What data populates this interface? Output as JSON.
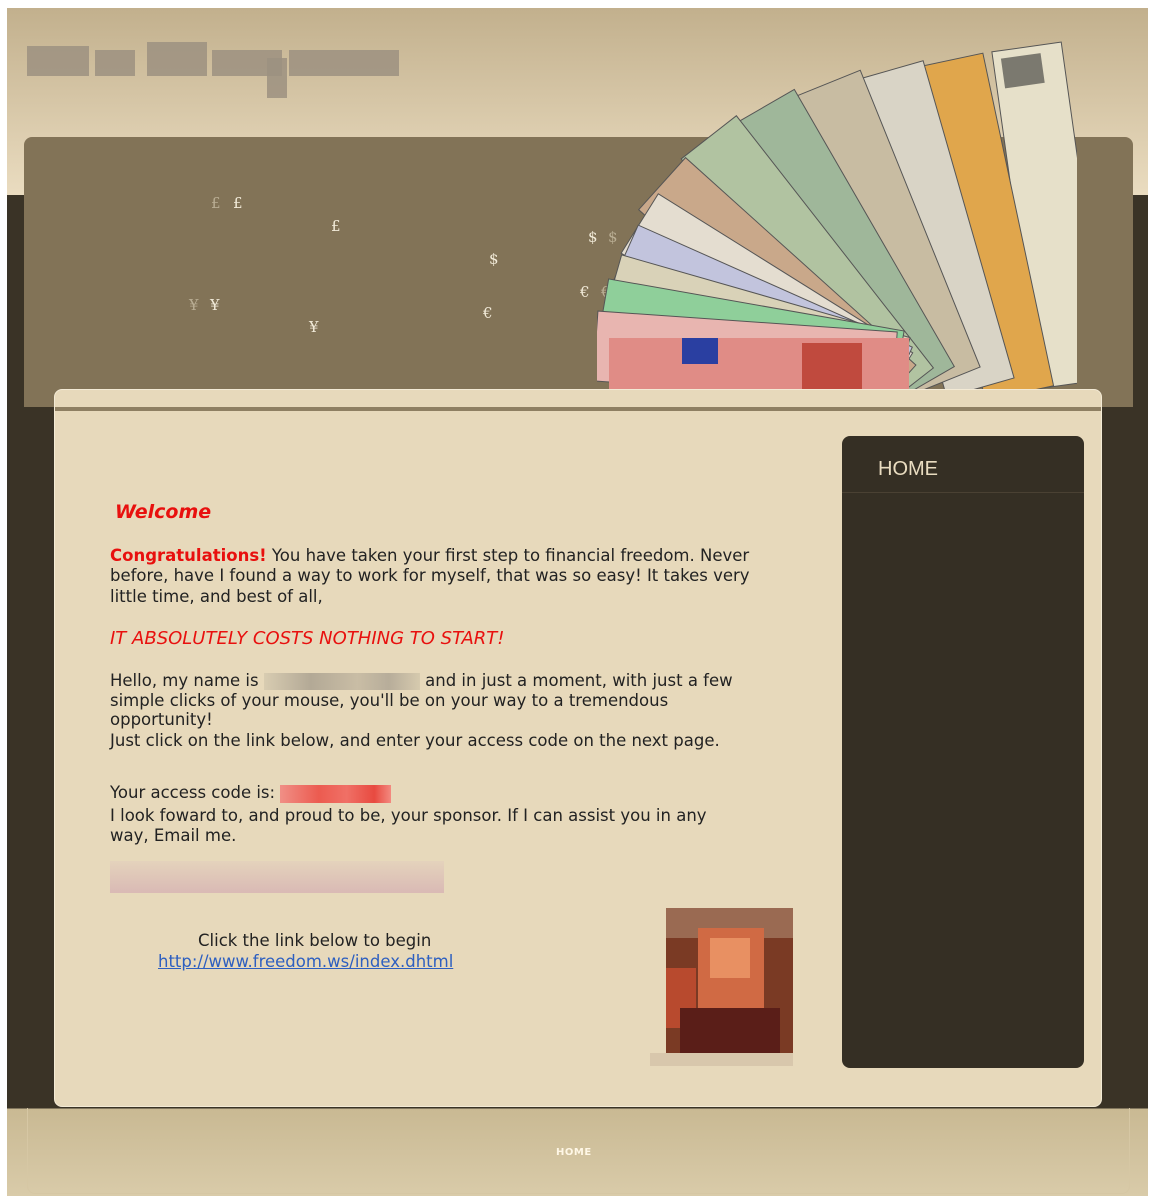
{
  "nav": {
    "home_label": "HOME"
  },
  "header": {
    "symbols": [
      "£",
      "£",
      "£",
      "$",
      "$",
      "$",
      "¥",
      "¥",
      "¥",
      "€",
      "€",
      "€"
    ]
  },
  "main": {
    "welcome": "Welcome",
    "congrats": "Congratulations!",
    "intro_line1": " You have taken your first step to financial freedom. Never",
    "intro_line2": "before, have I found a way to work for myself, that was so easy! It takes very",
    "intro_line3": "little time, and best of all,",
    "costs_headline": "IT ABSOLUTELY COSTS NOTHING TO START!",
    "hello_prefix": "Hello, my name is",
    "hello_suffix": "and in just a moment, with just a few",
    "simple_line": "simple clicks of your mouse, you'll be on your way to a tremendous",
    "opportunity_line": "opportunity!",
    "click_below_line": "Just click on the link below, and enter your access code on the next page.",
    "access_code_label": "Your access code is:",
    "sponsor_line1": "I look foward to, and proud to be, your sponsor. If I can assist you in any",
    "sponsor_line2": "way, Email me.",
    "begin_text": "Click the link below  to begin",
    "begin_link": "http://www.freedom.ws/index.dhtml"
  },
  "footer": {
    "home_label": "HOME"
  },
  "colors": {
    "accent_red": "#e8100e",
    "sidebar_bg": "#352f24",
    "content_bg": "#e7d9bb",
    "header_bg": "#827357",
    "link": "#2d5fc0"
  }
}
